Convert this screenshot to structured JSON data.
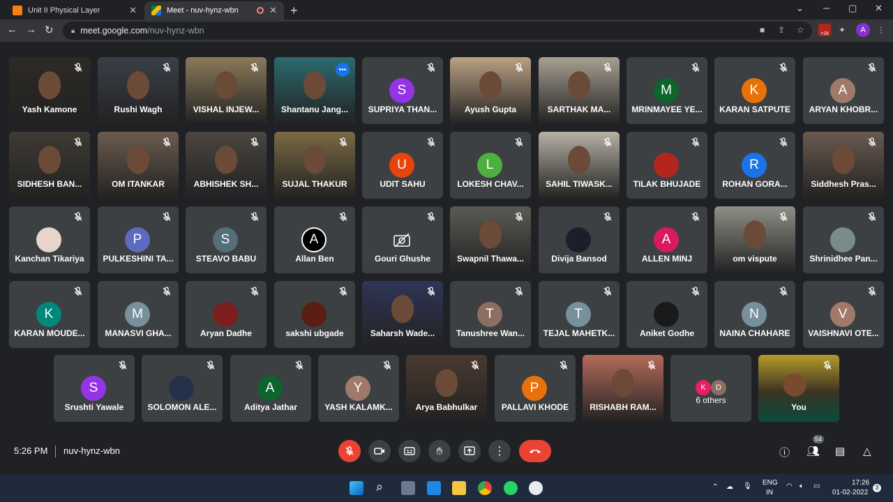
{
  "browser": {
    "tabs": [
      {
        "title": "Unit II Physical Layer",
        "active": false
      },
      {
        "title": "Meet - nuv-hynz-wbn",
        "active": true
      }
    ],
    "url_host": "meet.google.com",
    "url_path": "/nuv-hynz-wbn",
    "profile_initial": "A",
    "ext_badge": ">1k"
  },
  "participants": [
    {
      "name": "Yash Kamone",
      "video": true,
      "color": "#2d2a26"
    },
    {
      "name": "Rushi Wagh",
      "video": true,
      "color": "#3a3f48"
    },
    {
      "name": "VISHAL INJEW...",
      "video": true,
      "color": "#8a7a5a"
    },
    {
      "name": "Shantanu Jang...",
      "video": true,
      "color": "#2b6a6f"
    },
    {
      "name": "SUPRIYA THAN...",
      "initial": "S",
      "color": "#9334e6"
    },
    {
      "name": "Ayush Gupta",
      "video": true,
      "color": "#b9a184"
    },
    {
      "name": "SARTHAK MA...",
      "video": true,
      "color": "#a7a091"
    },
    {
      "name": "MRINMAYEE YE...",
      "initial": "M",
      "color": "#0d652d"
    },
    {
      "name": "KARAN SATPUTE",
      "initial": "K",
      "color": "#e8710a"
    },
    {
      "name": "ARYAN KHOBR...",
      "initial": "A",
      "color": "#a0796b"
    },
    {
      "name": "SIDHESH BAN...",
      "video": true,
      "color": "#3e3a33"
    },
    {
      "name": "OM ITANKAR",
      "video": true,
      "color": "#6c5b4f"
    },
    {
      "name": "ABHISHEK SH...",
      "video": true,
      "color": "#4a4540"
    },
    {
      "name": "SUJAL THAKUR",
      "video": true,
      "color": "#7a6a44"
    },
    {
      "name": "UDIT SAHU",
      "initial": "U",
      "color": "#e8430a"
    },
    {
      "name": "LOKESH CHAV...",
      "initial": "L",
      "color": "#4caf3f"
    },
    {
      "name": "SAHIL TIWASK...",
      "video": true,
      "color": "#b7b1a5"
    },
    {
      "name": "TILAK BHUJADE",
      "initial": "",
      "color": "#b3261e"
    },
    {
      "name": "ROHAN GORA...",
      "initial": "R",
      "color": "#1a73e8"
    },
    {
      "name": "Siddhesh Pras...",
      "video": true,
      "color": "#6a5a50"
    },
    {
      "name": "Kanchan Tikariya",
      "initial": "",
      "color": "#e8d4c8"
    },
    {
      "name": "PULKESHINI TA...",
      "initial": "P",
      "color": "#5c6bc0"
    },
    {
      "name": "STEAVO BABU",
      "initial": "S",
      "color": "#546e7a"
    },
    {
      "name": "Allan Ben",
      "initial": "A",
      "color": "#000000"
    },
    {
      "name": "Gouri Ghushe",
      "initial": "",
      "color": "#3c4043"
    },
    {
      "name": "Swapnil Thawa...",
      "video": true,
      "color": "#5a5a55"
    },
    {
      "name": "Divija Bansod",
      "initial": "",
      "color": "#1b1f2a"
    },
    {
      "name": "ALLEN MINJ",
      "initial": "A",
      "color": "#d81b60"
    },
    {
      "name": "om vispute",
      "video": true,
      "color": "#8f8f88"
    },
    {
      "name": "Shrinidhee Pan...",
      "initial": "",
      "color": "#7b8a8a"
    },
    {
      "name": "KARAN MOUDE...",
      "initial": "K",
      "color": "#00897b"
    },
    {
      "name": "MANASVI GHA...",
      "initial": "M",
      "color": "#78909c"
    },
    {
      "name": "Aryan Dadhe",
      "initial": "",
      "color": "#7d1e1e"
    },
    {
      "name": "sakshi ubgade",
      "initial": "",
      "color": "#5a1e12"
    },
    {
      "name": "Saharsh Wade...",
      "video": true,
      "color": "#2f3556"
    },
    {
      "name": "Tanushree Wan...",
      "initial": "T",
      "color": "#8d6e63"
    },
    {
      "name": "TEJAL MAHETK...",
      "initial": "T",
      "color": "#78909c"
    },
    {
      "name": "Aniket Godhe",
      "initial": "",
      "color": "#1a1a1a"
    },
    {
      "name": "NAINA CHAHARE",
      "initial": "N",
      "color": "#78909c"
    },
    {
      "name": "VAISHNAVI OTE...",
      "initial": "V",
      "color": "#a0796b"
    },
    {
      "name": "Srushti Yawale",
      "initial": "S",
      "color": "#9334e6"
    },
    {
      "name": "SOLOMON ALE...",
      "initial": "",
      "color": "#23324a"
    },
    {
      "name": "Aditya Jathar",
      "initial": "A",
      "color": "#0d652d"
    },
    {
      "name": "YASH KALAMK...",
      "initial": "Y",
      "color": "#a0796b"
    },
    {
      "name": "Arya Babhulkar",
      "video": true,
      "color": "#4a3a30"
    },
    {
      "name": "PALLAVI KHODE",
      "initial": "P",
      "color": "#e8710a"
    },
    {
      "name": "RISHABH RAM...",
      "video": true,
      "color": "#b46a5a"
    }
  ],
  "others": {
    "label": "6 others",
    "initials": [
      "K",
      "D"
    ],
    "colors": [
      "#e91e63",
      "#8d6e63"
    ]
  },
  "self": {
    "name": "You",
    "color": "#3b3423"
  },
  "meeting": {
    "time": "5:26 PM",
    "code": "nuv-hynz-wbn",
    "people_count": "54"
  },
  "taskbar": {
    "lang": "ENG",
    "region": "IN",
    "time": "17:26",
    "date": "01-02-2022",
    "notif": "3"
  }
}
